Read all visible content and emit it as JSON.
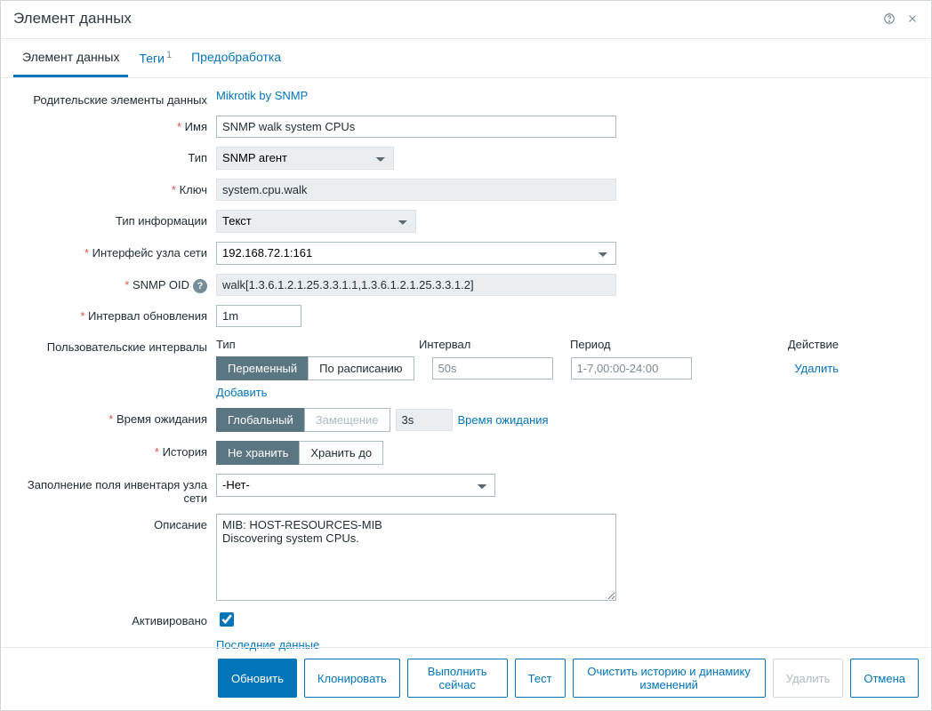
{
  "dialog": {
    "title": "Элемент данных"
  },
  "tabs": {
    "item": "Элемент данных",
    "tags": "Теги",
    "tags_count": "1",
    "preproc": "Предобработка"
  },
  "labels": {
    "parent": "Родительские элементы данных",
    "name": "Имя",
    "type": "Тип",
    "key": "Ключ",
    "info_type": "Тип информации",
    "interface": "Интерфейс узла сети",
    "snmp_oid": "SNMP OID",
    "update_interval": "Интервал обновления",
    "custom_intervals": "Пользовательские интервалы",
    "timeout": "Время ожидания",
    "history": "История",
    "inventory": "Заполнение поля инвентаря узла сети",
    "description": "Описание",
    "enabled": "Активировано"
  },
  "parent_link": "Mikrotik by SNMP",
  "name_value": "SNMP walk system CPUs",
  "type_value": "SNMP агент",
  "key_value": "system.cpu.walk",
  "info_type_value": "Текст",
  "interface_value": "192.168.72.1:161",
  "snmp_oid_value": "walk[1.3.6.1.2.1.25.3.3.1.1,1.3.6.1.2.1.25.3.3.1.2]",
  "update_interval_value": "1m",
  "ci": {
    "head_type": "Тип",
    "head_interval": "Интервал",
    "head_period": "Период",
    "head_action": "Действие",
    "seg_flex": "Переменный",
    "seg_sched": "По расписанию",
    "interval_ph": "50s",
    "period_ph": "1-7,00:00-24:00",
    "delete": "Удалить",
    "add": "Добавить"
  },
  "timeout": {
    "seg_global": "Глобальный",
    "seg_override": "Замещение",
    "value": "3s",
    "link": "Время ожидания"
  },
  "history": {
    "seg_nostore": "Не хранить",
    "seg_storeuntil": "Хранить до"
  },
  "inventory_value": "-Нет-",
  "description_value": "MIB: HOST-RESOURCES-MIB\nDiscovering system CPUs.",
  "latest_data": "Последние данные",
  "buttons": {
    "update": "Обновить",
    "clone": "Клонировать",
    "execute": "Выполнить сейчас",
    "test": "Тест",
    "clear": "Очистить историю и динамику изменений",
    "delete": "Удалить",
    "cancel": "Отмена"
  }
}
